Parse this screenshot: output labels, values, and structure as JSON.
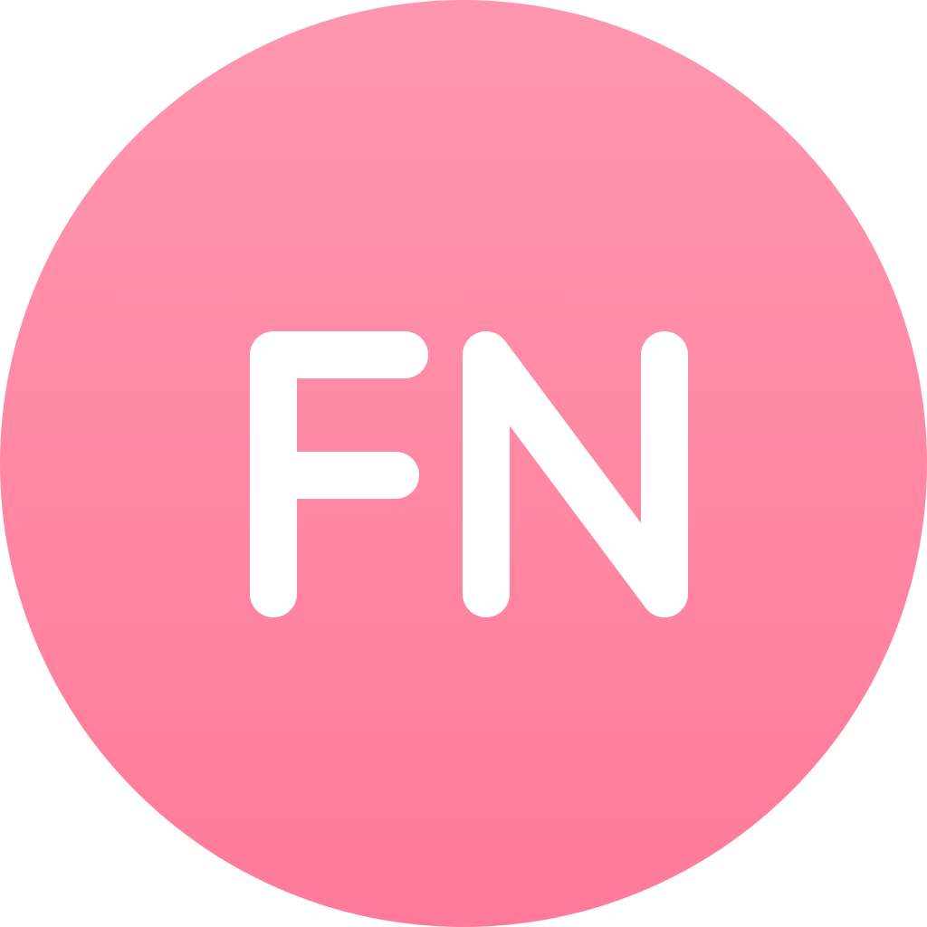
{
  "avatar": {
    "initials": "FN",
    "background_top_color": "#ff96b0",
    "background_bottom_color": "#ff7a9a",
    "text_color": "#ffffff"
  }
}
